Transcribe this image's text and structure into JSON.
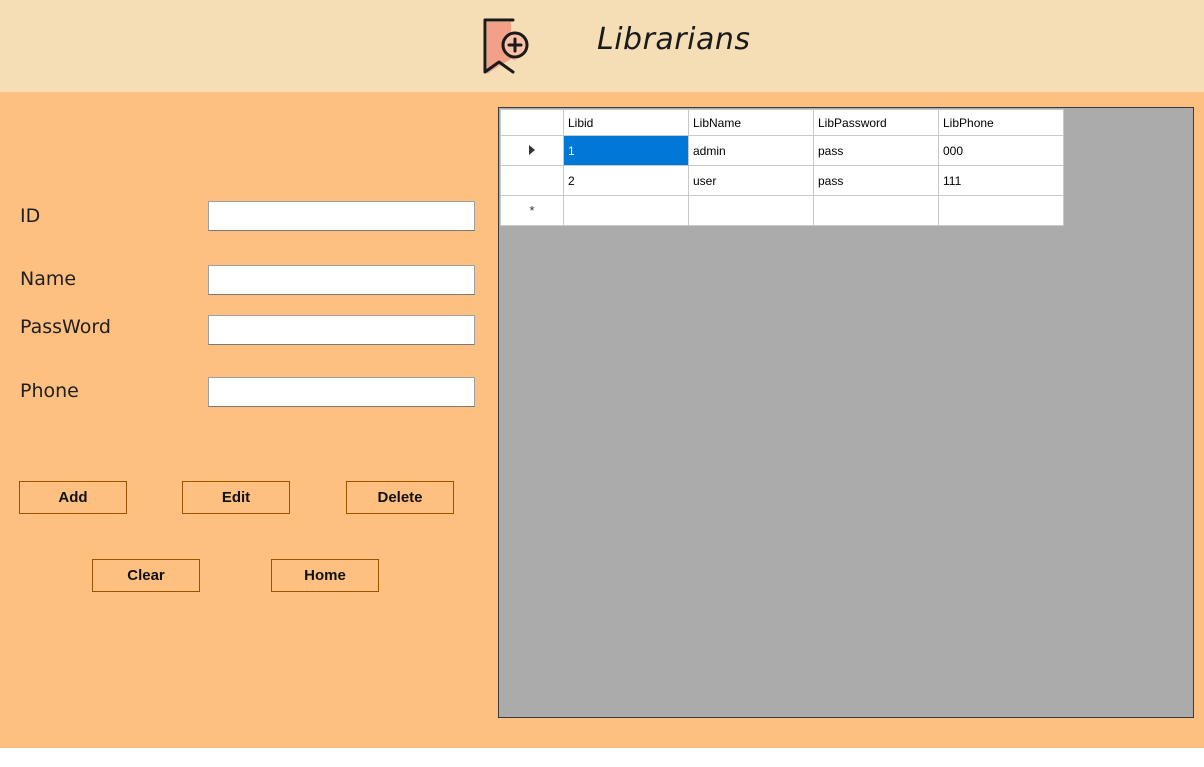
{
  "header": {
    "title": "Librarians",
    "icon": "bookmark-add-icon"
  },
  "form": {
    "fields": [
      {
        "label": "ID",
        "value": ""
      },
      {
        "label": "Name",
        "value": ""
      },
      {
        "label": "PassWord",
        "value": ""
      },
      {
        "label": "Phone",
        "value": ""
      }
    ]
  },
  "buttons": {
    "add": "Add",
    "edit": "Edit",
    "delete": "Delete",
    "clear": "Clear",
    "home": "Home"
  },
  "grid": {
    "columns": [
      "Libid",
      "LibName",
      "LibPassword",
      "LibPhone"
    ],
    "rows": [
      [
        "1",
        "admin",
        "pass",
        "000"
      ],
      [
        "2",
        "user",
        "pass",
        "111"
      ]
    ],
    "new_row_marker": "*",
    "selected_cell": "row 1, Libid"
  },
  "colors": {
    "header_bg": "#f5deb5",
    "panel_bg": "#fec080",
    "grid_bg": "#ababab",
    "selection": "#0078d7",
    "button_border": "#9a5400"
  }
}
